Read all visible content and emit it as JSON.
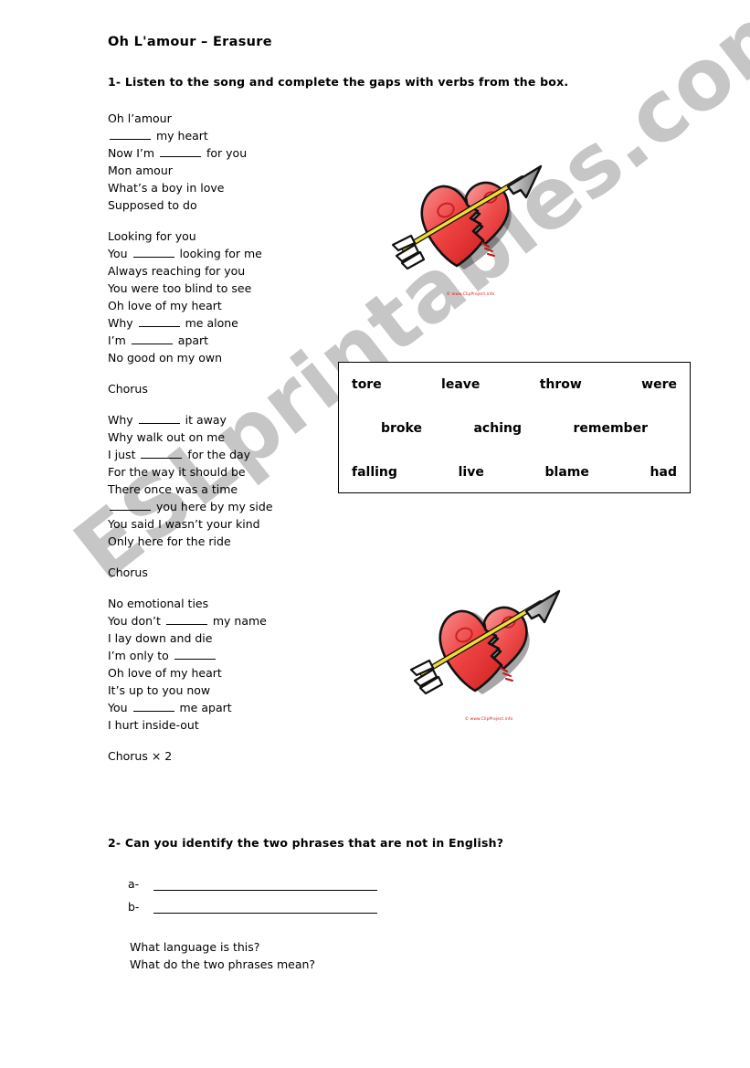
{
  "title": "Oh L'amour – Erasure",
  "exercise_1": {
    "instruction": "1- Listen to the song and complete the gaps with verbs from the box."
  },
  "lyrics": {
    "stanzas": [
      {
        "lines": [
          {
            "before": "Oh l’amour",
            "blank": false,
            "after": ""
          },
          {
            "before": "",
            "blank": true,
            "after": " my heart"
          },
          {
            "before": "Now I’m ",
            "blank": true,
            "after": " for you"
          },
          {
            "before": "Mon amour",
            "blank": false,
            "after": ""
          },
          {
            "before": "What’s a boy in love",
            "blank": false,
            "after": ""
          },
          {
            "before": "Supposed to do",
            "blank": false,
            "after": ""
          }
        ]
      },
      {
        "lines": [
          {
            "before": "Looking for you",
            "blank": false,
            "after": ""
          },
          {
            "before": "You ",
            "blank": true,
            "after": " looking for me"
          },
          {
            "before": "Always reaching for you",
            "blank": false,
            "after": ""
          },
          {
            "before": "You were too blind to see",
            "blank": false,
            "after": ""
          },
          {
            "before": "Oh love of my heart",
            "blank": false,
            "after": ""
          },
          {
            "before": "Why ",
            "blank": true,
            "after": " me alone"
          },
          {
            "before": "I’m ",
            "blank": true,
            "after": " apart"
          },
          {
            "before": "No good on my own",
            "blank": false,
            "after": ""
          }
        ]
      },
      {
        "lines": [
          {
            "before": "Chorus",
            "blank": false,
            "after": ""
          }
        ]
      },
      {
        "lines": [
          {
            "before": "Why ",
            "blank": true,
            "after": " it away"
          },
          {
            "before": "Why walk out on me",
            "blank": false,
            "after": ""
          },
          {
            "before": "I just ",
            "blank": true,
            "after": " for the day"
          },
          {
            "before": "For the way it should be",
            "blank": false,
            "after": ""
          },
          {
            "before": "There once was a time",
            "blank": false,
            "after": ""
          },
          {
            "before": "",
            "blank": true,
            "after": " you here by my side"
          },
          {
            "before": "You said I wasn’t your kind",
            "blank": false,
            "after": ""
          },
          {
            "before": "Only here for the ride",
            "blank": false,
            "after": ""
          }
        ]
      },
      {
        "lines": [
          {
            "before": "Chorus",
            "blank": false,
            "after": ""
          }
        ]
      },
      {
        "lines": [
          {
            "before": "No emotional ties",
            "blank": false,
            "after": ""
          },
          {
            "before": "You don’t ",
            "blank": true,
            "after": " my name"
          },
          {
            "before": "I lay down and die",
            "blank": false,
            "after": ""
          },
          {
            "before": "I’m only to ",
            "blank": true,
            "after": ""
          },
          {
            "before": "Oh love of my heart",
            "blank": false,
            "after": ""
          },
          {
            "before": "It’s up to you now",
            "blank": false,
            "after": ""
          },
          {
            "before": "You ",
            "blank": true,
            "after": " me apart"
          },
          {
            "before": "I hurt inside-out",
            "blank": false,
            "after": ""
          }
        ]
      },
      {
        "lines": [
          {
            "before": "Chorus × 2",
            "blank": false,
            "after": ""
          }
        ]
      }
    ]
  },
  "word_box": {
    "rows": [
      [
        "tore",
        "leave",
        "throw",
        "were"
      ],
      [
        "broke",
        "aching",
        "remember"
      ],
      [
        "falling",
        "live",
        "blame",
        "had"
      ]
    ]
  },
  "clipart": {
    "credit": "© www.ClipProject.info",
    "heart_fill": "#ef3b3b",
    "heart_fill_light": "#f57d7d",
    "arrow_shaft": "#f2dd2e",
    "arrow_head": "#b3b3b3"
  },
  "exercise_2": {
    "instruction": "2- Can you identify the two phrases that are not in English?",
    "answers": [
      {
        "label": "a-"
      },
      {
        "label": "b-"
      }
    ],
    "followups": [
      "What language is this?",
      "What do the two phrases mean?"
    ]
  },
  "watermark": {
    "text": "ESLprintables.com",
    "color": "#c6c6c6"
  }
}
